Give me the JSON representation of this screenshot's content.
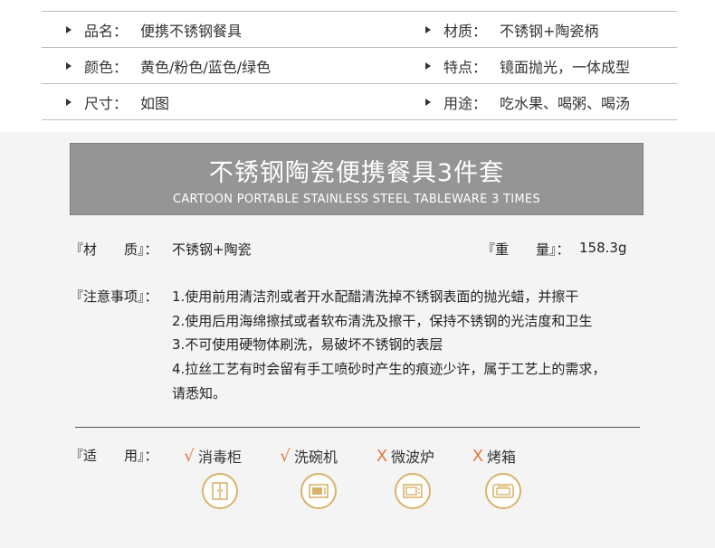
{
  "specs": [
    [
      {
        "label": "品名：",
        "value": "便携不锈钢餐具"
      },
      {
        "label": "材质：",
        "value": "不锈钢+陶瓷柄"
      }
    ],
    [
      {
        "label": "颜色：",
        "value": "黄色/粉色/蓝色/绿色"
      },
      {
        "label": "特点：",
        "value": "镜面抛光，一体成型"
      }
    ],
    [
      {
        "label": "尺寸：",
        "value": "如图"
      },
      {
        "label": "用途：",
        "value": "吃水果、喝粥、喝汤"
      }
    ]
  ],
  "banner": {
    "title": "不锈钢陶瓷便携餐具3件套",
    "subtitle": "CARTOON PORTABLE STAINLESS STEEL TABLEWARE 3 TIMES"
  },
  "material": {
    "label": "『材　　质』：",
    "value": "不锈钢+陶瓷"
  },
  "weight": {
    "label": "『重　　量』：",
    "value": "158.3g"
  },
  "notes": {
    "label": "『注意事项』：",
    "lines": [
      "1.使用前用清洁剂或者开水配醋清洗掉不锈钢表面的抛光蜡，并擦干",
      "2.使用后用海绵擦拭或者软布清洗及擦干，保持不锈钢的光洁度和卫生",
      "3.不可使用硬物体刷洗，易破坏不锈钢的表层",
      "4.拉丝工艺有时会留有手工喷砂时产生的痕迹少许，属于工艺上的需求，",
      "请悉知。"
    ]
  },
  "usage": {
    "label": "『适　　用』：",
    "items": [
      {
        "mark": "√",
        "text": "消毒柜",
        "icon": "disinfection-cabinet-icon"
      },
      {
        "mark": "√",
        "text": "洗碗机",
        "icon": "dishwasher-icon"
      },
      {
        "mark": "X",
        "text": "微波炉",
        "icon": "microwave-icon"
      },
      {
        "mark": "X",
        "text": "烤箱",
        "icon": "oven-icon"
      }
    ]
  },
  "colors": {
    "accent": "#d8b36a",
    "mark": "#e07a3a",
    "banner": "#959595"
  }
}
